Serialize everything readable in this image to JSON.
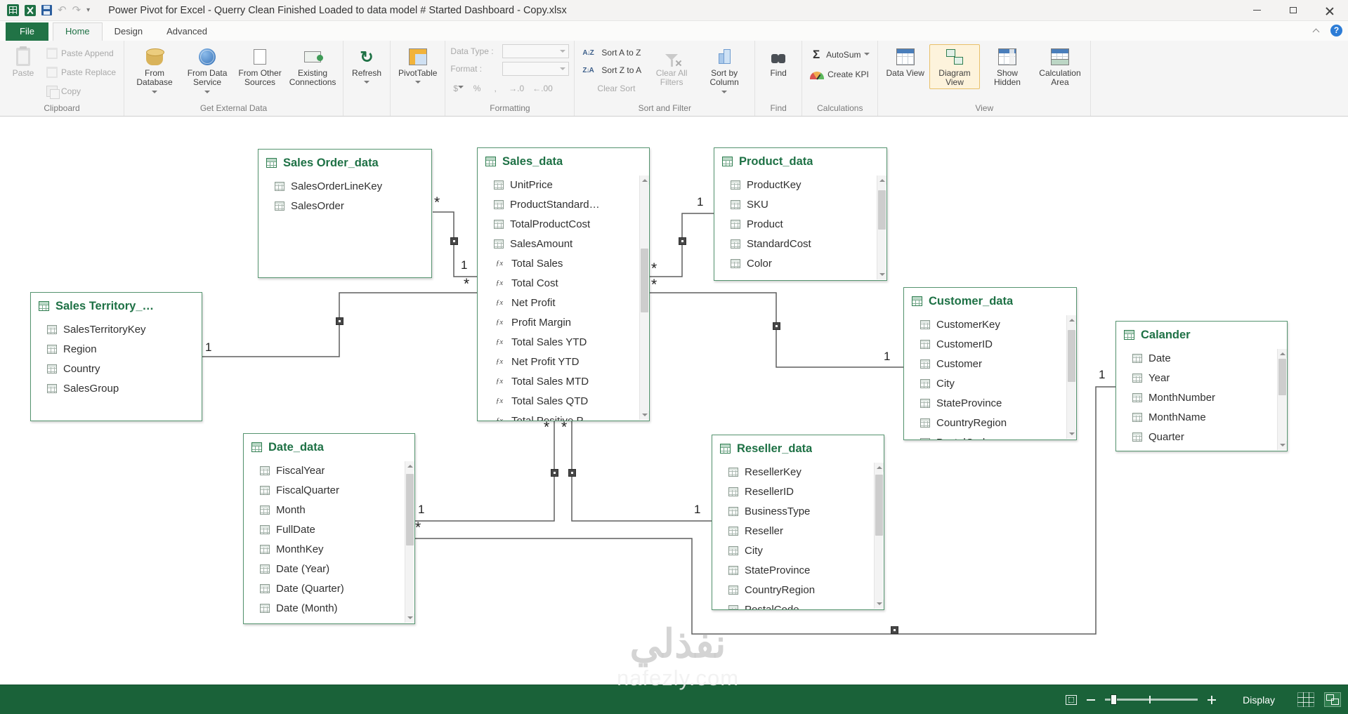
{
  "window": {
    "title": "Power Pivot for Excel - Querry Clean Finished Loaded to data model # Started Dashboard - Copy.xlsx"
  },
  "tabs": {
    "file": "File",
    "home": "Home",
    "design": "Design",
    "advanced": "Advanced"
  },
  "ribbon": {
    "clipboard": {
      "label": "Clipboard",
      "paste": "Paste",
      "paste_append": "Paste Append",
      "paste_replace": "Paste Replace",
      "copy": "Copy"
    },
    "external": {
      "label": "Get External Data",
      "from_database": "From Database",
      "from_data_service": "From Data Service",
      "from_other_sources": "From Other Sources",
      "existing_connections": "Existing Connections"
    },
    "refresh": {
      "label": "Refresh"
    },
    "pivottable": {
      "label": "PivotTable"
    },
    "formatting": {
      "label": "Formatting",
      "data_type": "Data Type :",
      "format": "Format :",
      "currency": "$",
      "percent": "%",
      "comma": ",",
      "inc_decimal": "→.0",
      "dec_decimal": "←.00"
    },
    "sort_filter": {
      "label": "Sort and Filter",
      "sort_az": "Sort A to Z",
      "sort_za": "Sort Z to A",
      "clear_sort": "Clear Sort",
      "clear_all_filters": "Clear All Filters",
      "sort_by_column": "Sort by Column"
    },
    "find": {
      "label": "Find",
      "find": "Find"
    },
    "calculations": {
      "label": "Calculations",
      "autosum": "AutoSum",
      "create_kpi": "Create KPI"
    },
    "view": {
      "label": "View",
      "data_view": "Data View",
      "diagram_view": "Diagram View",
      "show_hidden": "Show Hidden",
      "calculation_area": "Calculation Area"
    }
  },
  "glyphs": {
    "fx": "ƒx",
    "sigma": "Σ",
    "sort_az": "A↓Z",
    "sort_za": "Z↓A",
    "undo": "↶",
    "redo": "↷",
    "refresh": "↻",
    "caret": "▾",
    "help": "?"
  },
  "diagram": {
    "tables": [
      {
        "name": "Sales Order_data",
        "fields": [
          {
            "label": "SalesOrderLineKey",
            "type": "col"
          },
          {
            "label": "SalesOrder",
            "type": "col"
          }
        ]
      },
      {
        "name": "Sales_data",
        "fields": [
          {
            "label": "UnitPrice",
            "type": "col"
          },
          {
            "label": "ProductStandard…",
            "type": "col"
          },
          {
            "label": "TotalProductCost",
            "type": "col"
          },
          {
            "label": "SalesAmount",
            "type": "col"
          },
          {
            "label": "Total Sales",
            "type": "fx"
          },
          {
            "label": "Total Cost",
            "type": "fx"
          },
          {
            "label": "Net Profit",
            "type": "fx"
          },
          {
            "label": "Profit Margin",
            "type": "fx"
          },
          {
            "label": "Total Sales YTD",
            "type": "fx"
          },
          {
            "label": "Net Profit YTD",
            "type": "fx"
          },
          {
            "label": "Total Sales MTD",
            "type": "fx"
          },
          {
            "label": "Total Sales QTD",
            "type": "fx"
          },
          {
            "label": "Total Positive P…",
            "type": "fx"
          }
        ]
      },
      {
        "name": "Product_data",
        "fields": [
          {
            "label": "ProductKey",
            "type": "col"
          },
          {
            "label": "SKU",
            "type": "col"
          },
          {
            "label": "Product",
            "type": "col"
          },
          {
            "label": "StandardCost",
            "type": "col"
          },
          {
            "label": "Color",
            "type": "col"
          }
        ]
      },
      {
        "name": "Sales Territory_…",
        "fields": [
          {
            "label": "SalesTerritoryKey",
            "type": "col"
          },
          {
            "label": "Region",
            "type": "col"
          },
          {
            "label": "Country",
            "type": "col"
          },
          {
            "label": "SalesGroup",
            "type": "col"
          }
        ]
      },
      {
        "name": "Customer_data",
        "fields": [
          {
            "label": "CustomerKey",
            "type": "col"
          },
          {
            "label": "CustomerID",
            "type": "col"
          },
          {
            "label": "Customer",
            "type": "col"
          },
          {
            "label": "City",
            "type": "col"
          },
          {
            "label": "StateProvince",
            "type": "col"
          },
          {
            "label": "CountryRegion",
            "type": "col"
          },
          {
            "label": "PostalCode",
            "type": "col"
          }
        ]
      },
      {
        "name": "Calander",
        "fields": [
          {
            "label": "Date",
            "type": "col"
          },
          {
            "label": "Year",
            "type": "col"
          },
          {
            "label": "MonthNumber",
            "type": "col"
          },
          {
            "label": "MonthName",
            "type": "col"
          },
          {
            "label": "Quarter",
            "type": "col"
          }
        ]
      },
      {
        "name": "Date_data",
        "fields": [
          {
            "label": "FiscalYear",
            "type": "col"
          },
          {
            "label": "FiscalQuarter",
            "type": "col"
          },
          {
            "label": "Month",
            "type": "col"
          },
          {
            "label": "FullDate",
            "type": "col"
          },
          {
            "label": "MonthKey",
            "type": "col"
          },
          {
            "label": "Date (Year)",
            "type": "col"
          },
          {
            "label": "Date (Quarter)",
            "type": "col"
          },
          {
            "label": "Date (Month)",
            "type": "col"
          }
        ]
      },
      {
        "name": "Reseller_data",
        "fields": [
          {
            "label": "ResellerKey",
            "type": "col"
          },
          {
            "label": "ResellerID",
            "type": "col"
          },
          {
            "label": "BusinessType",
            "type": "col"
          },
          {
            "label": "Reseller",
            "type": "col"
          },
          {
            "label": "City",
            "type": "col"
          },
          {
            "label": "StateProvince",
            "type": "col"
          },
          {
            "label": "CountryRegion",
            "type": "col"
          },
          {
            "label": "PostalCode",
            "type": "col"
          }
        ]
      }
    ],
    "relationships": [
      {
        "from": "Sales Order_data",
        "to": "Sales_data",
        "from_card": "*",
        "to_card": "1"
      },
      {
        "from": "Sales Territory_…",
        "to": "Sales_data",
        "from_card": "1",
        "to_card": "*"
      },
      {
        "from": "Sales_data",
        "to": "Product_data",
        "from_card": "*",
        "to_card": "1"
      },
      {
        "from": "Sales_data",
        "to": "Customer_data",
        "from_card": "*",
        "to_card": "1"
      },
      {
        "from": "Date_data",
        "to": "Sales_data",
        "from_card": "1",
        "to_card": "*"
      },
      {
        "from": "Reseller_data",
        "to": "Sales_data",
        "from_card": "1",
        "to_card": "*"
      },
      {
        "from": "Date_data",
        "to": "Calander",
        "from_card": "*",
        "to_card": "1"
      }
    ]
  },
  "watermark": {
    "arabic": "نفذلي",
    "domain": "nafezly.com"
  },
  "statusbar": {
    "display_label": "Display"
  }
}
